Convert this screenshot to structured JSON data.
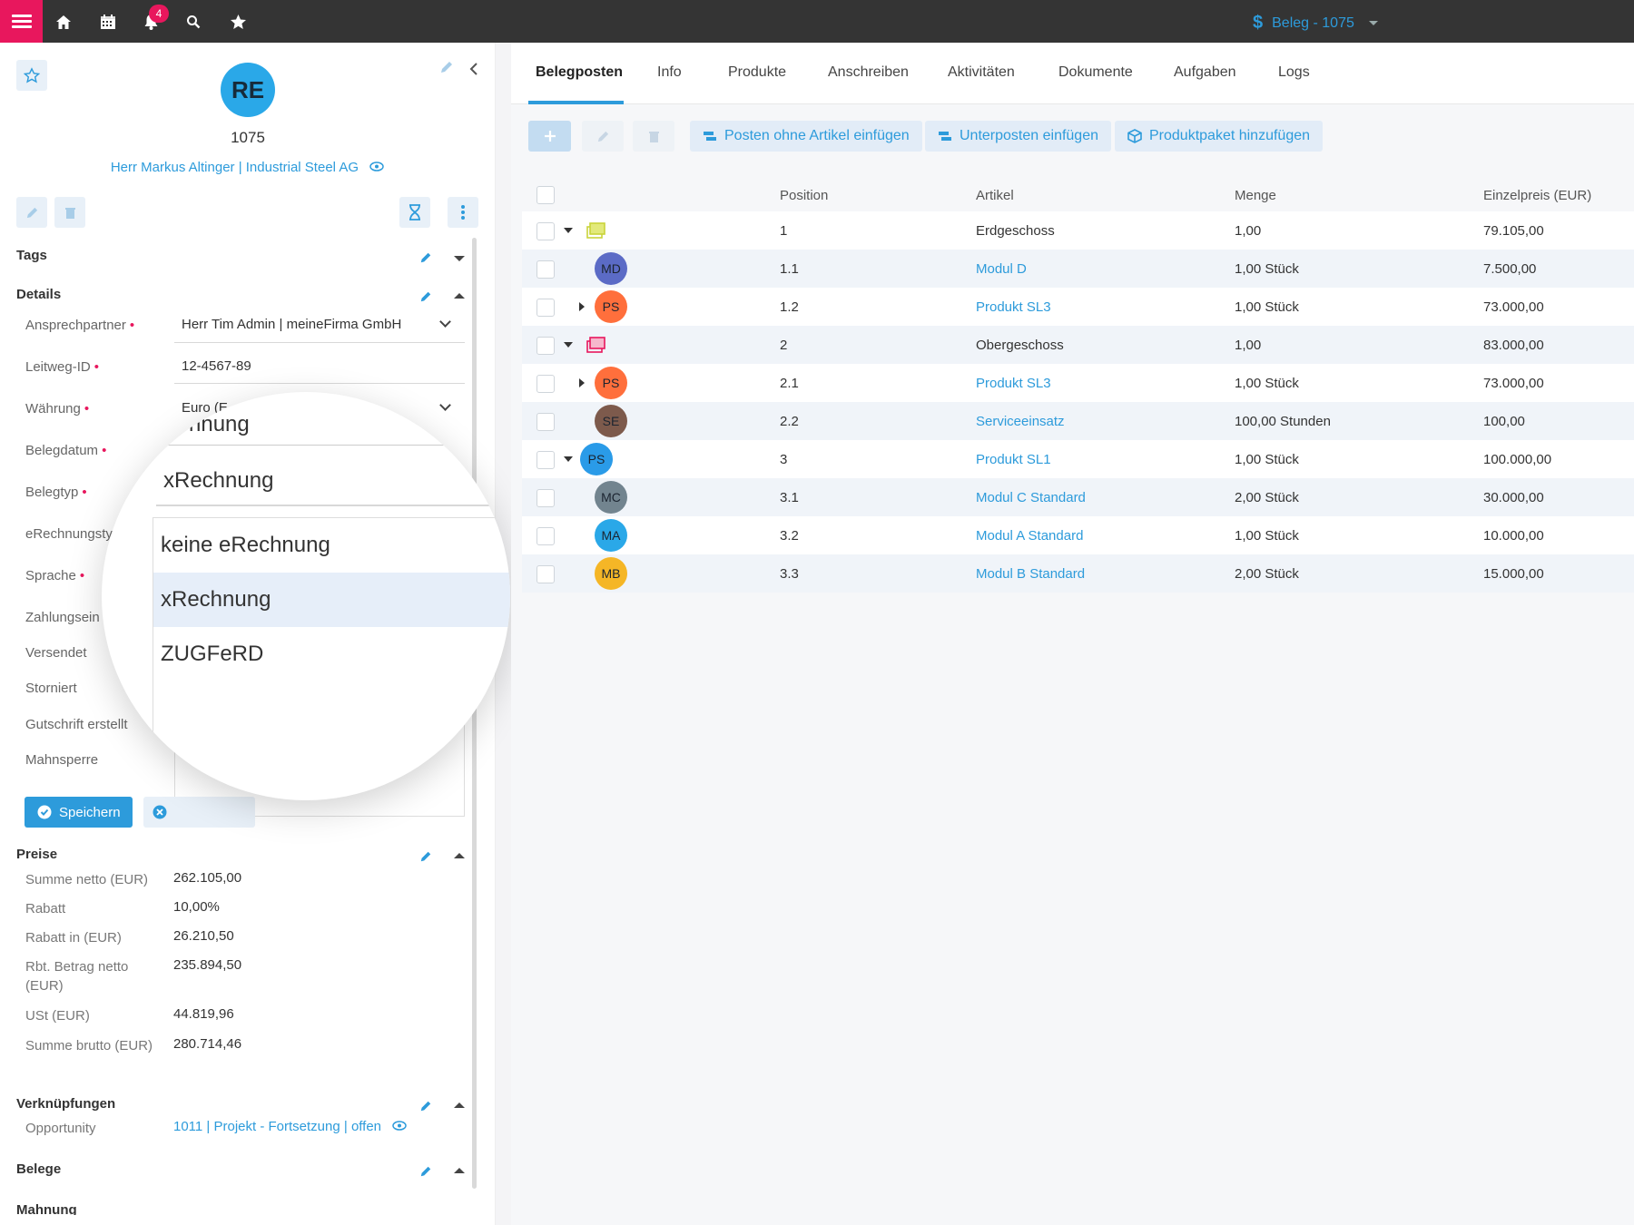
{
  "topbar": {
    "notif_count": "4",
    "beleg_title": "Beleg - 1075",
    "icons": [
      "hamburger-icon",
      "home-icon",
      "calendar-icon",
      "bell-icon",
      "search-icon",
      "star-icon"
    ]
  },
  "record": {
    "avatar_initials": "RE",
    "number": "1075",
    "contact": "Herr Markus Altinger | Industrial Steel AG"
  },
  "sections": {
    "tags": "Tags",
    "details": "Details",
    "preise": "Preise",
    "verknuepfungen": "Verknüpfungen",
    "belege": "Belege",
    "mahnung": "Mahnung"
  },
  "details": {
    "ansprechpartner_label": "Ansprechpartner",
    "ansprechpartner_value": "Herr Tim Admin | meineFirma GmbH",
    "leitweg_label": "Leitweg-ID",
    "leitweg_value": "12-4567-89",
    "waehrung_label": "Währung",
    "waehrung_value": "Euro (E",
    "belegdatum_label": "Belegdatum",
    "belegtyp_label": "Belegtyp",
    "erechnungstyp_label": "eRechnungsty",
    "sprache_label": "Sprache",
    "zahlung_label": "Zahlungsein",
    "versendet_label": "Versendet",
    "storniert_label": "Storniert",
    "gutschrift_label": "Gutschrift erstellt",
    "mahnsperre_label": "Mahnsperre",
    "save_label": "Speichern"
  },
  "magnifier": {
    "top_text": "nnung",
    "current_value": "xRechnung",
    "options": [
      "keine eRechnung",
      "xRechnung",
      "ZUGFeRD"
    ],
    "selected_index": 1
  },
  "preise": {
    "rows": [
      {
        "label": "Summe netto (EUR)",
        "value": "262.105,00"
      },
      {
        "label": "Rabatt",
        "value": "10,00%"
      },
      {
        "label": "Rabatt in (EUR)",
        "value": "26.210,50"
      },
      {
        "label": "Rbt. Betrag netto (EUR)",
        "value": "235.894,50"
      },
      {
        "label": "USt (EUR)",
        "value": "44.819,96"
      },
      {
        "label": "Summe brutto (EUR)",
        "value": "280.714,46"
      }
    ]
  },
  "verknuepfungen": {
    "opportunity_label": "Opportunity",
    "opportunity_value": "1011 | Projekt - Fortsetzung | offen"
  },
  "tabs": [
    "Belegposten",
    "Info",
    "Produkte",
    "Anschreiben",
    "Aktivitäten",
    "Dokumente",
    "Aufgaben",
    "Logs"
  ],
  "toolbar": {
    "posten_ohne_artikel": "Posten ohne Artikel einfügen",
    "unterposten": "Unterposten einfügen",
    "produktpaket": "Produktpaket hinzufügen"
  },
  "table": {
    "headers": {
      "position": "Position",
      "artikel": "Artikel",
      "menge": "Menge",
      "einzelpreis": "Einzelpreis (EUR)"
    },
    "rows": [
      {
        "position": "1",
        "artikel": "Erdgeschoss",
        "menge": "1,00",
        "preis": "79.105,00",
        "avatar": "",
        "avatar_color": "#d6e05a",
        "kind": "package"
      },
      {
        "position": "1.1",
        "artikel": "Modul D",
        "menge": "1,00 Stück",
        "preis": "7.500,00",
        "avatar": "MD",
        "avatar_color": "#5b6bc6",
        "kind": "item"
      },
      {
        "position": "1.2",
        "artikel": "Produkt SL3",
        "menge": "1,00 Stück",
        "preis": "73.000,00",
        "avatar": "PS",
        "avatar_color": "#ff6f3c",
        "kind": "item"
      },
      {
        "position": "2",
        "artikel": "Obergeschoss",
        "menge": "1,00",
        "preis": "83.000,00",
        "avatar": "",
        "avatar_color": "#e8175d",
        "kind": "package"
      },
      {
        "position": "2.1",
        "artikel": "Produkt SL3",
        "menge": "1,00 Stück",
        "preis": "73.000,00",
        "avatar": "PS",
        "avatar_color": "#ff6f3c",
        "kind": "item"
      },
      {
        "position": "2.2",
        "artikel": "Serviceeinsatz",
        "menge": "100,00 Stunden",
        "preis": "100,00",
        "avatar": "SE",
        "avatar_color": "#7d5a4c",
        "kind": "item"
      },
      {
        "position": "3",
        "artikel": "Produkt SL1",
        "menge": "1,00 Stück",
        "preis": "100.000,00",
        "avatar": "PS",
        "avatar_color": "#2a9be8",
        "kind": "item"
      },
      {
        "position": "3.1",
        "artikel": "Modul C Standard",
        "menge": "2,00 Stück",
        "preis": "30.000,00",
        "avatar": "MC",
        "avatar_color": "#72848f",
        "kind": "item"
      },
      {
        "position": "3.2",
        "artikel": "Modul A Standard",
        "menge": "1,00 Stück",
        "preis": "10.000,00",
        "avatar": "MA",
        "avatar_color": "#2aa8e8",
        "kind": "item"
      },
      {
        "position": "3.3",
        "artikel": "Modul B Standard",
        "menge": "2,00 Stück",
        "preis": "15.000,00",
        "avatar": "MB",
        "avatar_color": "#f5b626",
        "kind": "item"
      }
    ]
  }
}
